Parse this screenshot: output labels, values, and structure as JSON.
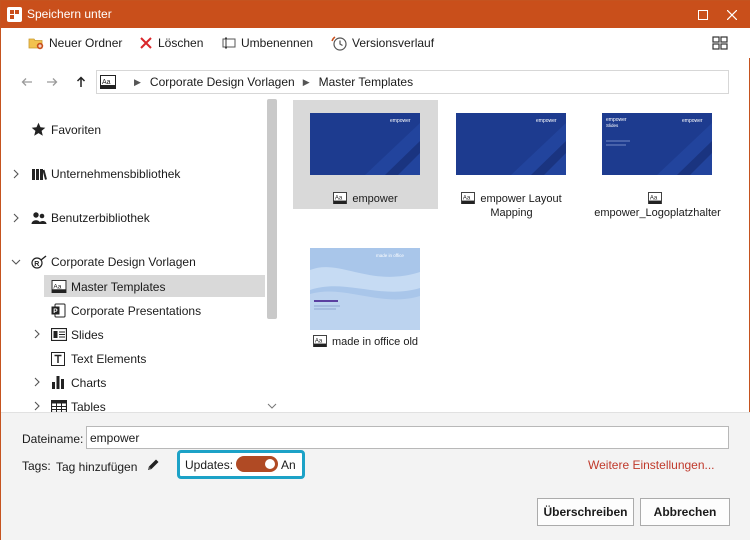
{
  "window": {
    "title": "Speichern unter"
  },
  "toolbar": {
    "new_folder": "Neuer Ordner",
    "delete": "Löschen",
    "rename": "Umbenennen",
    "version_history": "Versionsverlauf"
  },
  "breadcrumb": {
    "items": [
      "Corporate Design Vorlagen",
      "Master Templates"
    ]
  },
  "sidebar": {
    "items": [
      {
        "label": "Favoriten",
        "icon": "star-icon"
      },
      {
        "label": "Unternehmensbibliothek",
        "icon": "library-icon"
      },
      {
        "label": "Benutzerbibliothek",
        "icon": "users-icon"
      },
      {
        "label": "Corporate Design Vorlagen",
        "icon": "corporate-icon"
      },
      {
        "label": "Master Templates",
        "icon": "master-template-icon",
        "selected": true
      },
      {
        "label": "Corporate Presentations",
        "icon": "powerpoint-icon"
      },
      {
        "label": "Slides",
        "icon": "slides-icon"
      },
      {
        "label": "Text Elements",
        "icon": "text-element-icon"
      },
      {
        "label": "Charts",
        "icon": "chart-icon"
      },
      {
        "label": "Tables",
        "icon": "table-icon"
      }
    ]
  },
  "files": [
    {
      "name": "empower",
      "selected": true,
      "thumb_brand": "empower"
    },
    {
      "name": "empower Layout Mapping",
      "thumb_brand": "empower"
    },
    {
      "name": "empower_Logoplatzhalter",
      "thumb_brand": "empower",
      "thumb_caption": "Slides"
    },
    {
      "name": "made in office old",
      "thumb_brand": "made in office"
    }
  ],
  "footer": {
    "filename_label": "Dateiname:",
    "filename_value": "empower",
    "tags_label": "Tags:",
    "add_tag": "Tag hinzufügen",
    "updates_label": "Updates:",
    "updates_state": "An",
    "more_settings": "Weitere Einstellungen...",
    "overwrite": "Überschreiben",
    "cancel": "Abbrechen"
  },
  "colors": {
    "accent": "#c94f1b",
    "toggle_on": "#b04a24",
    "highlight_box": "#1ca2c7",
    "link": "#c0392b",
    "thumb_blue": "#1d3b8f"
  }
}
